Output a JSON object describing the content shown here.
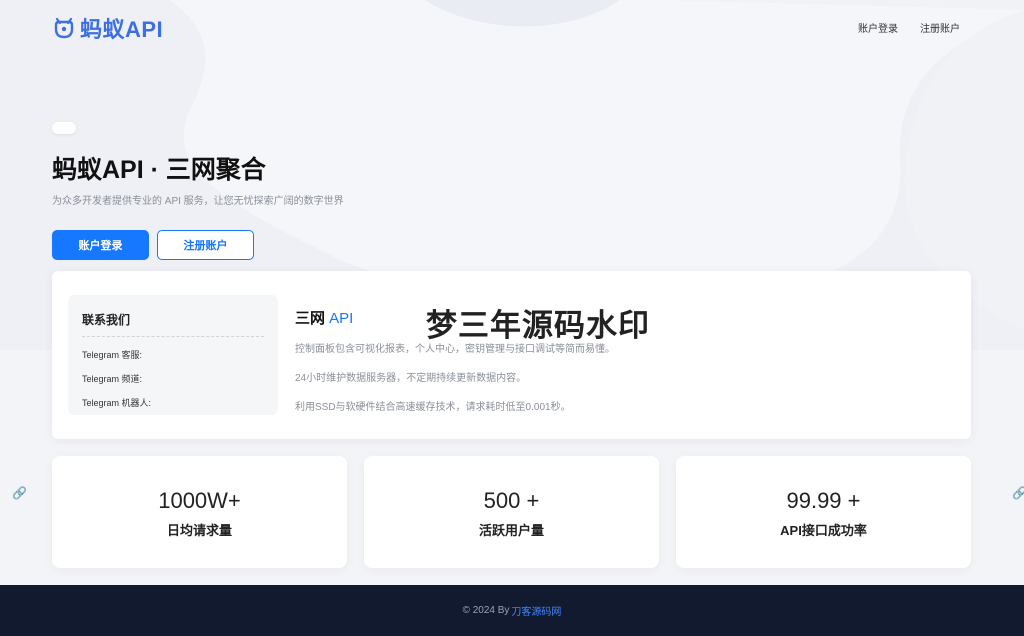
{
  "brand": {
    "name": "蚂蚁API",
    "accent": "#3d6fe0"
  },
  "nav": {
    "login": "账户登录",
    "register": "注册账户"
  },
  "hero": {
    "title_light": "蚂蚁API · ",
    "title_bold": "三网聚合",
    "subtitle": "为众多开发者提供专业的 API 服务，让您无忧探索广阔的数字世界",
    "btn_login": "账户登录",
    "btn_register": "注册账户"
  },
  "contact": {
    "title": "联系我们",
    "lines": [
      "Telegram 客服:",
      "Telegram 频道:",
      "Telegram 机器人:"
    ]
  },
  "features": {
    "title_a": "三网 ",
    "title_b": "API",
    "lines": [
      "控制面板包含可视化报表，个人中心，密钥管理与接口调试等简而易懂。",
      "24小时维护数据服务器，不定期持续更新数据内容。",
      "利用SSD与软硬件结合高速缓存技术，请求耗时低至0.001秒。"
    ]
  },
  "watermark": "梦三年源码水印",
  "stats": [
    {
      "value": "1000W+",
      "label": "日均请求量"
    },
    {
      "value": "500 +",
      "label": "活跃用户量"
    },
    {
      "value": "99.99 +",
      "label": "API接口成功率"
    }
  ],
  "footer": {
    "copyright": "© 2024 By",
    "link": "刀客源码网"
  },
  "colors": {
    "primary": "#1677ff",
    "footer_bg": "#121a2f"
  }
}
